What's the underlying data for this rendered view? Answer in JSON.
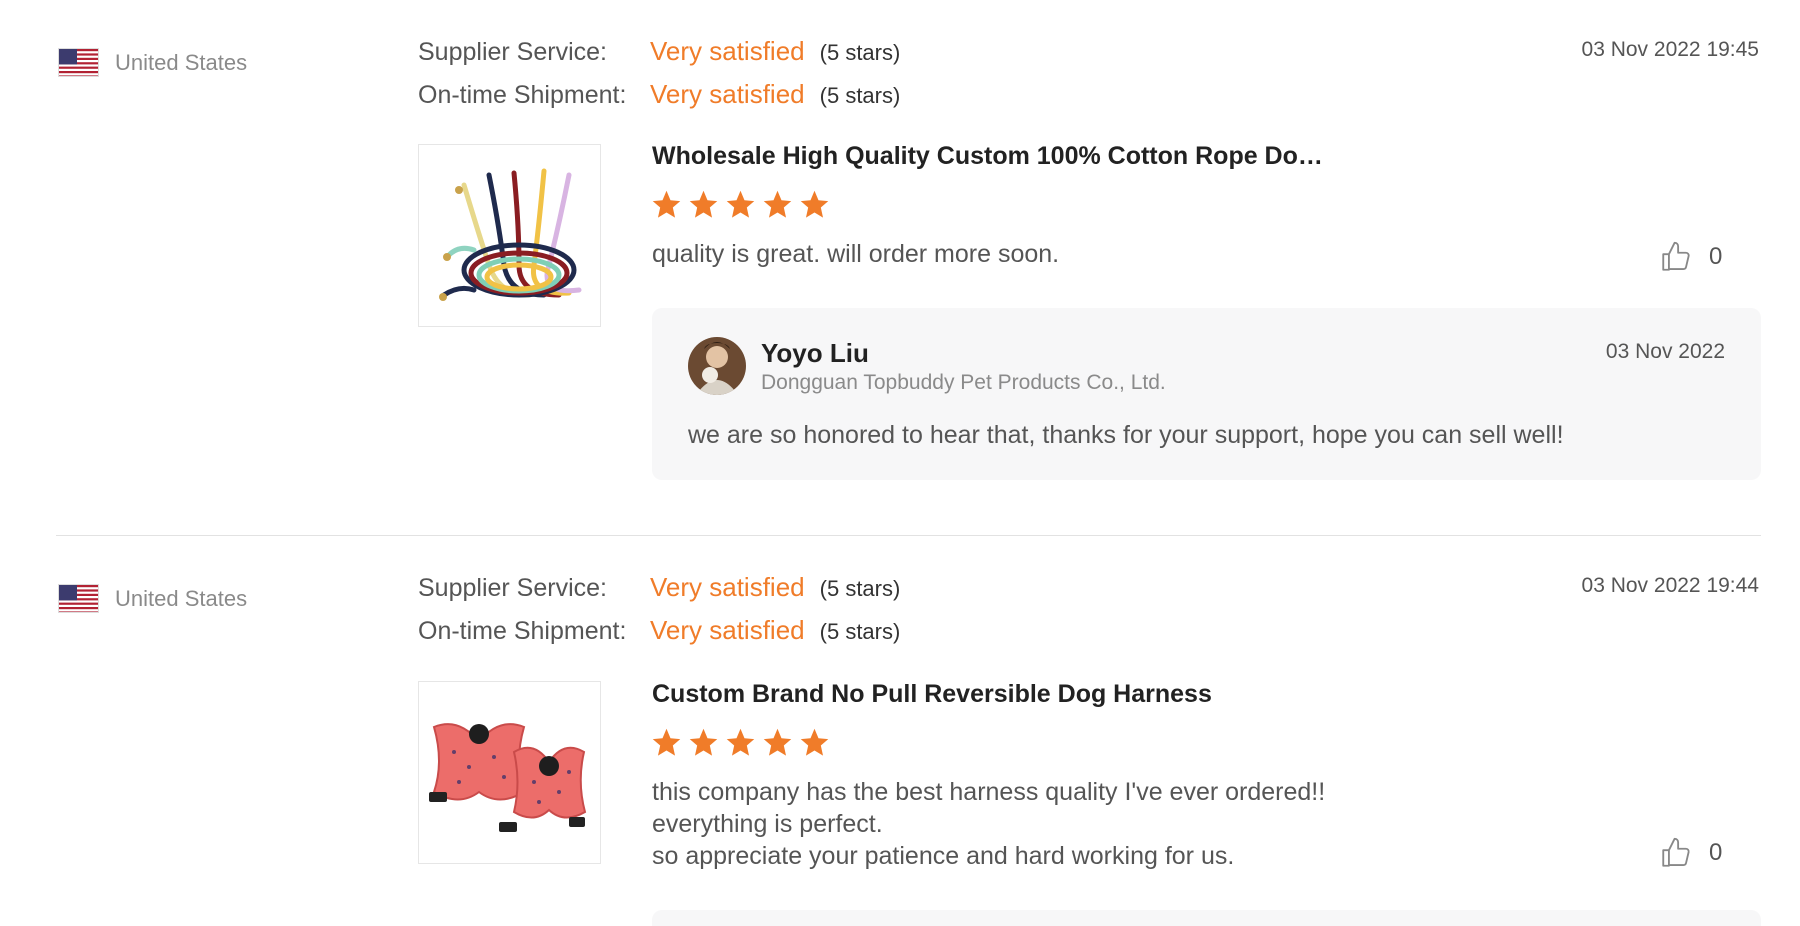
{
  "reviews": [
    {
      "country": "United States",
      "supplier_service_label": "Supplier Service:",
      "supplier_service_value": "Very satisfied",
      "supplier_service_stars": "(5 stars)",
      "shipment_label": "On-time Shipment:",
      "shipment_value": "Very satisfied",
      "shipment_stars": "(5 stars)",
      "date": "03 Nov 2022 19:45",
      "product_title": "Wholesale High Quality Custom 100% Cotton Rope Do…",
      "rating": 5,
      "comment_lines": [
        "quality is great. will order more soon."
      ],
      "likes": "0",
      "reply": {
        "name": "Yoyo Liu",
        "company": "Dongguan Topbuddy Pet Products Co., Ltd.",
        "date": "03 Nov 2022",
        "text": "we are so honored to hear that, thanks for your support, hope you can sell well!"
      }
    },
    {
      "country": "United States",
      "supplier_service_label": "Supplier Service:",
      "supplier_service_value": "Very satisfied",
      "supplier_service_stars": "(5 stars)",
      "shipment_label": "On-time Shipment:",
      "shipment_value": "Very satisfied",
      "shipment_stars": "(5 stars)",
      "date": "03 Nov 2022 19:44",
      "product_title": "Custom Brand No Pull Reversible Dog Harness",
      "rating": 5,
      "comment_lines": [
        "this company has the best harness quality I've ever ordered!!",
        "everything is perfect.",
        "so appreciate your patience and hard working for us."
      ],
      "likes": "0"
    }
  ],
  "colors": {
    "accent": "#f07c29",
    "star": "#f07c29",
    "reply_bg": "#f7f7f8"
  },
  "icons": {
    "flag": "us-flag-icon",
    "like": "thumbs-up-icon",
    "star": "star-icon"
  }
}
